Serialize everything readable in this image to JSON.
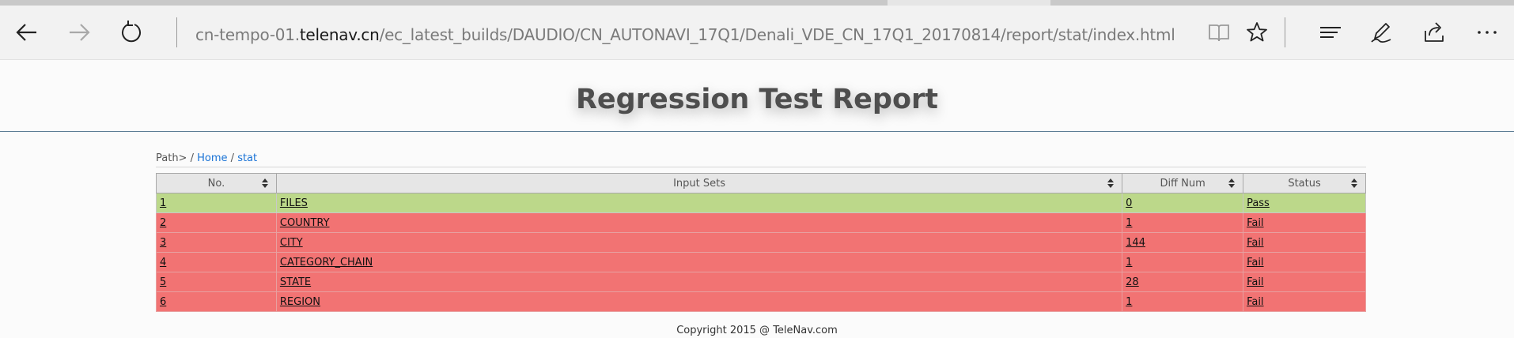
{
  "browser": {
    "url_prefix": "cn-tempo-01.",
    "url_host": "telenav.cn",
    "url_path": "/ec_latest_builds/DAUDIO/CN_AUTONAVI_17Q1/Denali_VDE_CN_17Q1_20170814/report/stat/index.html"
  },
  "page": {
    "title": "Regression Test Report",
    "path_label": "Path>",
    "path_sep": "/",
    "breadcrumb": [
      "Home",
      "stat"
    ],
    "footer": "Copyright 2015 @ TeleNav.com"
  },
  "table": {
    "headers": [
      "No.",
      "Input Sets",
      "Diff Num",
      "Status"
    ],
    "rows": [
      {
        "no": "1",
        "input_set": "FILES",
        "diff": "0",
        "status": "Pass"
      },
      {
        "no": "2",
        "input_set": "COUNTRY",
        "diff": "1",
        "status": "Fail"
      },
      {
        "no": "3",
        "input_set": "CITY",
        "diff": "144",
        "status": "Fail"
      },
      {
        "no": "4",
        "input_set": "CATEGORY_CHAIN",
        "diff": "1",
        "status": "Fail"
      },
      {
        "no": "5",
        "input_set": "STATE",
        "diff": "28",
        "status": "Fail"
      },
      {
        "no": "6",
        "input_set": "REGION",
        "diff": "1",
        "status": "Fail"
      }
    ]
  },
  "colors": {
    "pass_row": "#bcd88a",
    "fail_row": "#f27373",
    "link": "#1a73d6"
  },
  "icons": [
    "back-icon",
    "forward-icon",
    "refresh-icon",
    "reading-view-icon",
    "favorite-star-icon",
    "hub-icon",
    "web-note-icon",
    "share-icon",
    "more-icon",
    "sort-icon"
  ]
}
